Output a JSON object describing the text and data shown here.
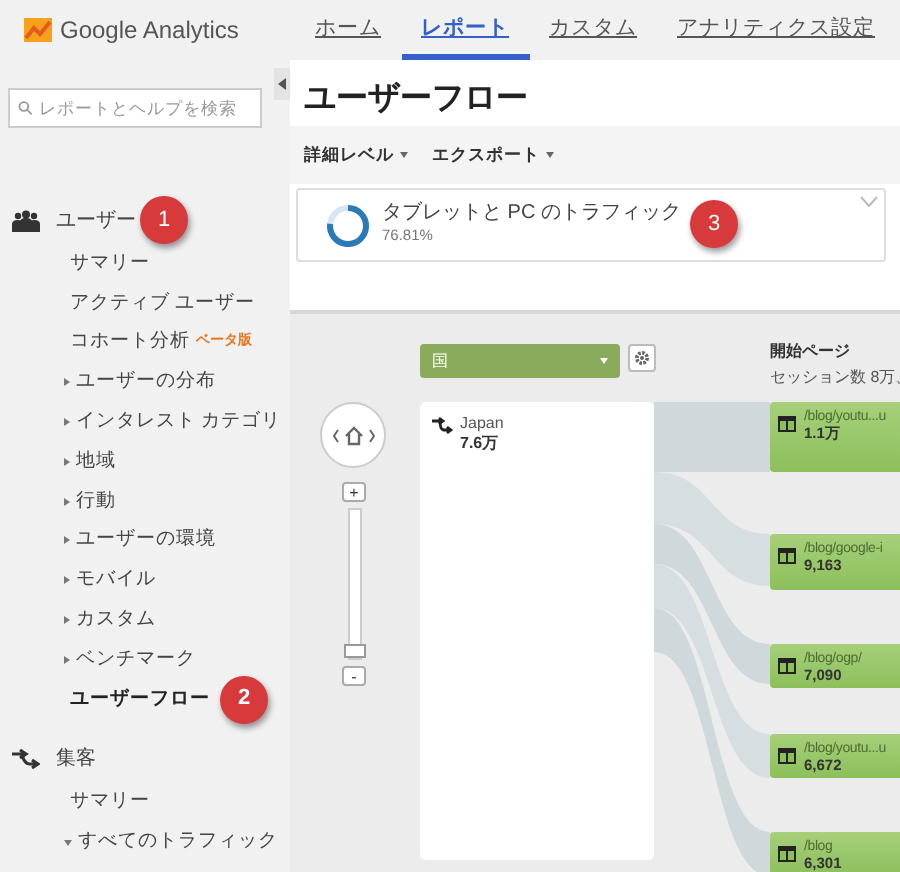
{
  "app": {
    "name": "Google Analytics"
  },
  "nav_tabs": [
    {
      "label": "ホーム",
      "selected": false
    },
    {
      "label": "レポート",
      "selected": true
    },
    {
      "label": "カスタム",
      "selected": false
    },
    {
      "label": "アナリティクス設定",
      "selected": false
    }
  ],
  "sidebar": {
    "search": {
      "placeholder": "レポートとヘルプを検索"
    },
    "sections": [
      {
        "label": "ユーザー",
        "badge": "1",
        "items": [
          {
            "label": "サマリー",
            "kind": "link",
            "selected": false
          },
          {
            "label": "アクティブ ユーザー",
            "kind": "link",
            "selected": false
          },
          {
            "label": "コホート分析",
            "tag": "ベータ版",
            "kind": "link",
            "selected": false
          },
          {
            "label": "ユーザーの分布",
            "kind": "collapsed",
            "selected": false
          },
          {
            "label": "インタレスト カテゴリ",
            "kind": "collapsed",
            "selected": false
          },
          {
            "label": "地域",
            "kind": "collapsed",
            "selected": false
          },
          {
            "label": "行動",
            "kind": "collapsed",
            "selected": false
          },
          {
            "label": "ユーザーの環境",
            "kind": "collapsed",
            "selected": false
          },
          {
            "label": "モバイル",
            "kind": "collapsed",
            "selected": false
          },
          {
            "label": "カスタム",
            "kind": "collapsed",
            "selected": false
          },
          {
            "label": "ベンチマーク",
            "kind": "collapsed",
            "selected": false
          },
          {
            "label": "ユーザーフロー",
            "kind": "link",
            "selected": true,
            "badge": "2"
          }
        ]
      },
      {
        "label": "集客",
        "items": [
          {
            "label": "サマリー",
            "kind": "link",
            "selected": false
          },
          {
            "label": "すべてのトラフィック",
            "kind": "expanded",
            "selected": false
          }
        ]
      }
    ]
  },
  "main": {
    "title": "ユーザーフロー",
    "toolbar": [
      {
        "label": "詳細レベル"
      },
      {
        "label": "エクスポート"
      }
    ],
    "segment": {
      "label": "タブレットと PC のトラフィック",
      "value": "76.81%",
      "level": 0.7681,
      "badge": "3"
    },
    "flow": {
      "dropdown": {
        "value": "国"
      },
      "zoom": {
        "level": 0.04,
        "zoom_in": "+",
        "zoom_out": "-"
      },
      "column_header": "開始ページ",
      "column_subheader": "セッション数 8万、",
      "source": {
        "label": "Japan",
        "value": "7.6万"
      },
      "pages": [
        {
          "label": "/blog/youtu...u",
          "value": "1.1万"
        },
        {
          "label": "/blog/google-i",
          "value": "9,163"
        },
        {
          "label": "/blog/ogp/",
          "value": "7,090"
        },
        {
          "label": "/blog/youtu...u",
          "value": "6,672"
        },
        {
          "label": "/blog",
          "value": "6,301"
        }
      ]
    }
  }
}
